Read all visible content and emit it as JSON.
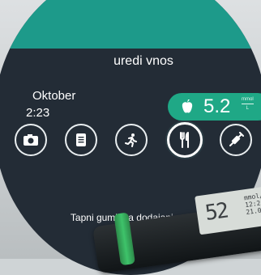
{
  "header": {
    "title": "uredi vnos"
  },
  "entry": {
    "date": "Oktober",
    "time": "2:23",
    "glucose_value": "5.2",
    "unit_top": "mmol",
    "unit_bottom": "L"
  },
  "action_buttons": [
    {
      "icon": "camera-icon"
    },
    {
      "icon": "note-icon"
    },
    {
      "icon": "running-icon"
    },
    {
      "icon": "meal-icon",
      "active": true
    },
    {
      "icon": "syringe-icon"
    }
  ],
  "hint_text": "Tapni gumb za dodajanje opombe",
  "meter": {
    "display_value": "52",
    "display_small_top": "mmol/",
    "display_small_mid": "12:2",
    "display_small_bot": "21.0"
  },
  "colors": {
    "accent": "#1fa886",
    "watch_face": "#232c36",
    "banner": "#1d9a8a"
  }
}
